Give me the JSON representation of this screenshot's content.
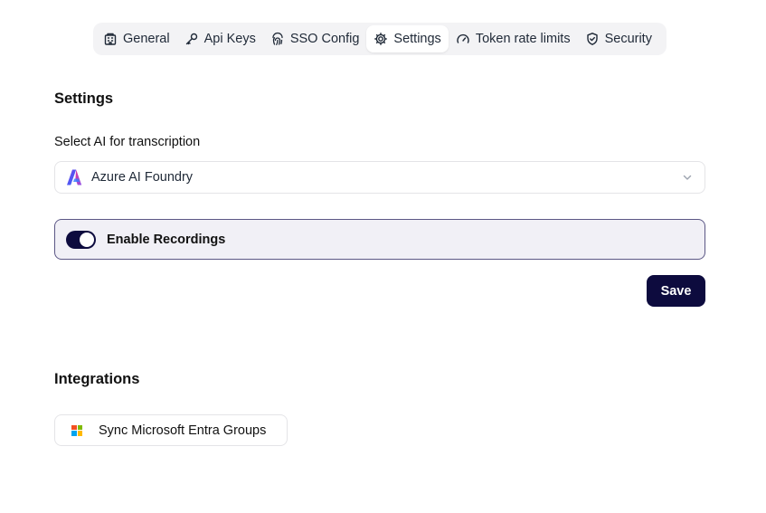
{
  "tabs": [
    {
      "label": "General",
      "icon": "building-icon"
    },
    {
      "label": "Api Keys",
      "icon": "key-icon"
    },
    {
      "label": "SSO Config",
      "icon": "fingerprint-icon"
    },
    {
      "label": "Settings",
      "icon": "gear-icon",
      "active": true
    },
    {
      "label": "Token rate limits",
      "icon": "gauge-icon"
    },
    {
      "label": "Security",
      "icon": "shield-check-icon"
    }
  ],
  "settings": {
    "title": "Settings",
    "transcription_label": "Select AI for transcription",
    "transcription_value": "Azure AI Foundry",
    "recordings_label": "Enable Recordings",
    "recordings_enabled": true,
    "save_label": "Save"
  },
  "integrations": {
    "title": "Integrations",
    "sync_label": "Sync Microsoft Entra Groups"
  },
  "colors": {
    "primary": "#0d0b3e",
    "toggle_row_bg": "#f1f0f6",
    "toggle_row_border": "#5b5785",
    "ms_red": "#f25022",
    "ms_green": "#7fba00",
    "ms_blue": "#00a4ef",
    "ms_yellow": "#ffb900"
  }
}
